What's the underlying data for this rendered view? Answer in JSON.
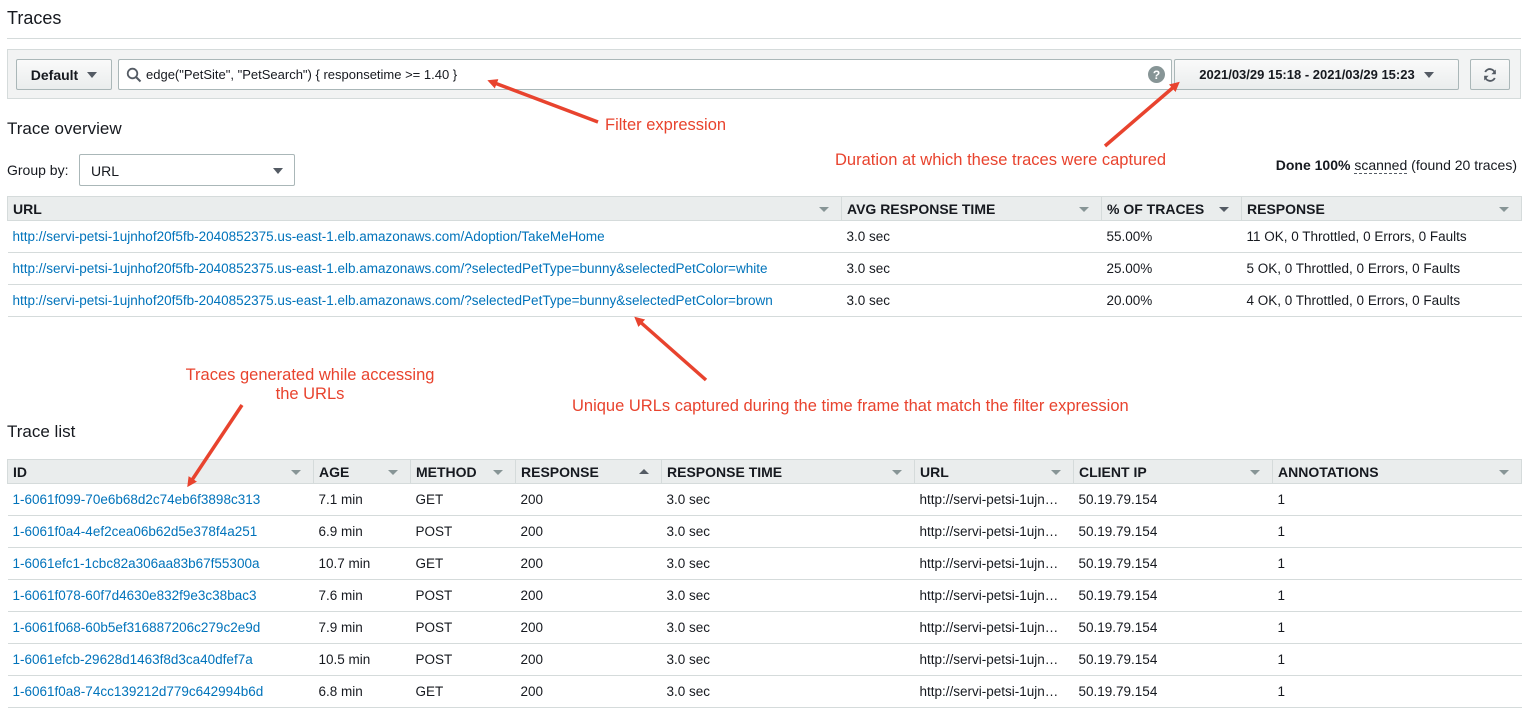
{
  "page": {
    "title": "Traces"
  },
  "toolbar": {
    "default_label": "Default",
    "filter_value": "edge(\"PetSite\", \"PetSearch\") { responsetime >= 1.40 }",
    "help_glyph": "?",
    "date_range": "2021/03/29 15:18 - 2021/03/29 15:23",
    "icons": {
      "search": "search-icon",
      "help": "help-icon",
      "refresh": "refresh-icon",
      "dropdown": "chevron-down-icon"
    }
  },
  "overview": {
    "title": "Trace overview",
    "group_by_label": "Group by:",
    "group_by_value": "URL",
    "scan_done": "Done",
    "scan_pct": "100%",
    "scan_text": "scanned",
    "scan_found": "(found 20 traces)",
    "columns": [
      "URL",
      "AVG RESPONSE TIME",
      "% OF TRACES",
      "RESPONSE"
    ],
    "rows": [
      {
        "url": "http://servi-petsi-1ujnhof20f5fb-2040852375.us-east-1.elb.amazonaws.com/Adoption/TakeMeHome",
        "avg": "3.0 sec",
        "pct": "55.00%",
        "response": "11 OK, 0 Throttled, 0 Errors, 0 Faults"
      },
      {
        "url": "http://servi-petsi-1ujnhof20f5fb-2040852375.us-east-1.elb.amazonaws.com/?selectedPetType=bunny&selectedPetColor=white",
        "avg": "3.0 sec",
        "pct": "25.00%",
        "response": "5 OK, 0 Throttled, 0 Errors, 0 Faults"
      },
      {
        "url": "http://servi-petsi-1ujnhof20f5fb-2040852375.us-east-1.elb.amazonaws.com/?selectedPetType=bunny&selectedPetColor=brown",
        "avg": "3.0 sec",
        "pct": "20.00%",
        "response": "4 OK, 0 Throttled, 0 Errors, 0 Faults"
      }
    ]
  },
  "trace_list": {
    "title": "Trace list",
    "columns": [
      "ID",
      "AGE",
      "METHOD",
      "RESPONSE",
      "RESPONSE TIME",
      "URL",
      "CLIENT IP",
      "ANNOTATIONS"
    ],
    "rows": [
      {
        "id": "1-6061f099-70e6b68d2c74eb6f3898c313",
        "age": "7.1 min",
        "method": "GET",
        "response": "200",
        "time": "3.0 sec",
        "url": "http://servi-petsi-1ujn…",
        "ip": "50.19.79.154",
        "annotations": "1"
      },
      {
        "id": "1-6061f0a4-4ef2cea06b62d5e378f4a251",
        "age": "6.9 min",
        "method": "POST",
        "response": "200",
        "time": "3.0 sec",
        "url": "http://servi-petsi-1ujn…",
        "ip": "50.19.79.154",
        "annotations": "1"
      },
      {
        "id": "1-6061efc1-1cbc82a306aa83b67f55300a",
        "age": "10.7 min",
        "method": "GET",
        "response": "200",
        "time": "3.0 sec",
        "url": "http://servi-petsi-1ujn…",
        "ip": "50.19.79.154",
        "annotations": "1"
      },
      {
        "id": "1-6061f078-60f7d4630e832f9e3c38bac3",
        "age": "7.6 min",
        "method": "POST",
        "response": "200",
        "time": "3.0 sec",
        "url": "http://servi-petsi-1ujn…",
        "ip": "50.19.79.154",
        "annotations": "1"
      },
      {
        "id": "1-6061f068-60b5ef316887206c279c2e9d",
        "age": "7.9 min",
        "method": "POST",
        "response": "200",
        "time": "3.0 sec",
        "url": "http://servi-petsi-1ujn…",
        "ip": "50.19.79.154",
        "annotations": "1"
      },
      {
        "id": "1-6061efcb-29628d1463f8d3ca40dfef7a",
        "age": "10.5 min",
        "method": "POST",
        "response": "200",
        "time": "3.0 sec",
        "url": "http://servi-petsi-1ujn…",
        "ip": "50.19.79.154",
        "annotations": "1"
      },
      {
        "id": "1-6061f0a8-74cc139212d779c642994b6d",
        "age": "6.8 min",
        "method": "GET",
        "response": "200",
        "time": "3.0 sec",
        "url": "http://servi-petsi-1ujn…",
        "ip": "50.19.79.154",
        "annotations": "1"
      }
    ]
  },
  "annotations": {
    "filter": "Filter expression",
    "duration": "Duration at which these traces were captured",
    "traces_line1": "Traces generated while accessing",
    "traces_line2": "the URLs",
    "unique": "Unique URLs captured during the time frame that match the filter expression"
  },
  "colors": {
    "link": "#0073bb",
    "annotation": "#e8432e",
    "header_bg": "#eaeded",
    "toolbar_bg": "#f2f3f3"
  }
}
